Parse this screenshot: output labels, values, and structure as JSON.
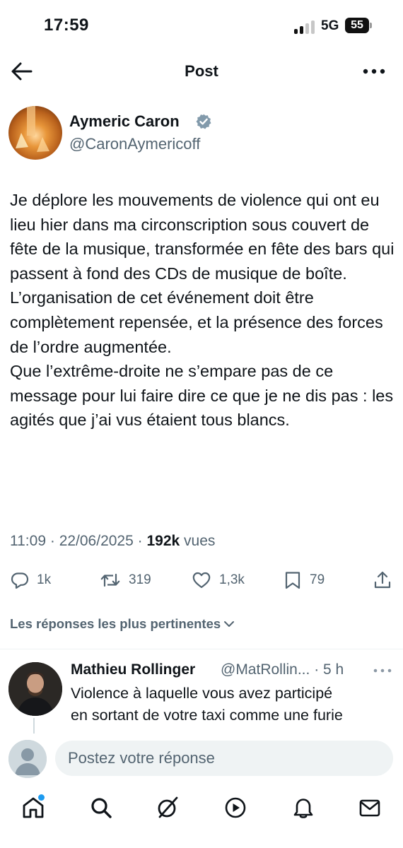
{
  "status_bar": {
    "time": "17:59",
    "network": "5G",
    "battery": "55"
  },
  "header": {
    "title": "Post"
  },
  "tweet": {
    "author_name": "Aymeric Caron",
    "author_handle": "@CaronAymericoff",
    "text": [
      "Je déplore les mouvements de violence qui ont eu lieu hier dans ma circonscription sous couvert de fête de la musique, transformée en fête des bars qui passent à fond des CDs de musique de boîte.",
      "L’organisation de cet événement doit être complètement repensée, et la présence des forces de l’ordre augmentée.",
      "Que l’extrême-droite ne s’empare pas de ce message pour lui faire dire ce que je ne dis pas : les agités que j’ai vus étaient tous blancs."
    ],
    "time": "11:09",
    "date": "22/06/2025",
    "separator": "·",
    "views_count": "192k",
    "views_label": "vues",
    "replies": "1k",
    "reposts": "319",
    "likes": "1,3k",
    "bookmarks": "79"
  },
  "replies_sort": {
    "label": "Les réponses les plus pertinentes"
  },
  "reply": {
    "name": "Mathieu Rollinger",
    "handle": "@MatRollin...",
    "time": "· 5 h",
    "text": [
      "Violence à laquelle vous avez participé",
      "en sortant de votre taxi comme une furie"
    ]
  },
  "compose": {
    "placeholder": "Postez votre réponse"
  },
  "colors": {
    "accent": "#1d9bf0",
    "secondary_text": "#536471",
    "verified": "#829aab"
  },
  "bottom_nav": {
    "items": [
      {
        "icon": "home-icon"
      },
      {
        "icon": "search-icon"
      },
      {
        "icon": "grok-icon"
      },
      {
        "icon": "play-icon"
      },
      {
        "icon": "bell-icon"
      },
      {
        "icon": "mail-icon"
      }
    ]
  }
}
